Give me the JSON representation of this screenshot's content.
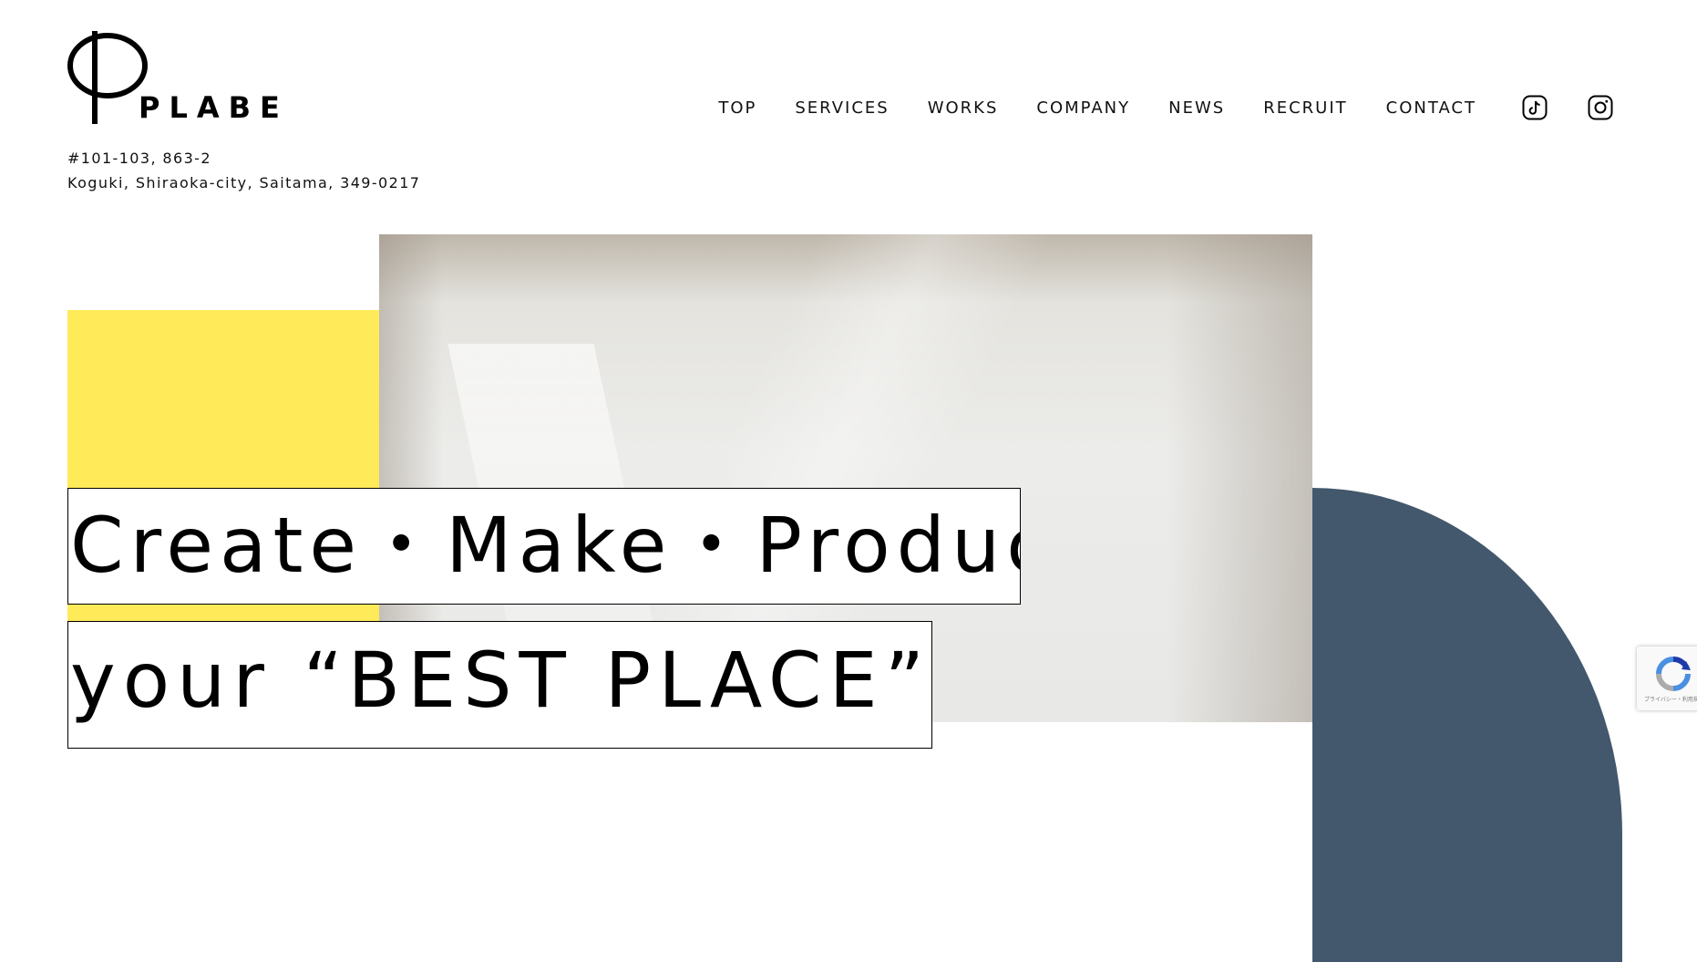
{
  "brand": {
    "wordmark": "PLABE"
  },
  "address": {
    "line1": "#101-103, 863-2",
    "line2": "Koguki, Shiraoka-city, Saitama, 349-0217"
  },
  "nav": {
    "items": [
      {
        "label": "TOP"
      },
      {
        "label": "SERVICES"
      },
      {
        "label": "WORKS"
      },
      {
        "label": "COMPANY"
      },
      {
        "label": "NEWS"
      },
      {
        "label": "RECRUIT"
      },
      {
        "label": "CONTACT"
      }
    ],
    "icons": [
      "tiktok-icon",
      "instagram-icon"
    ]
  },
  "hero": {
    "headline_line1": "Create・Make・Produce",
    "headline_line2": "your “BEST PLACE”"
  },
  "recaptcha": {
    "footer_text": "プライバシー・利用規約"
  },
  "colors": {
    "accent_yellow": "#ffea5a",
    "accent_navy": "#43586d",
    "text": "#000000",
    "background": "#ffffff"
  }
}
